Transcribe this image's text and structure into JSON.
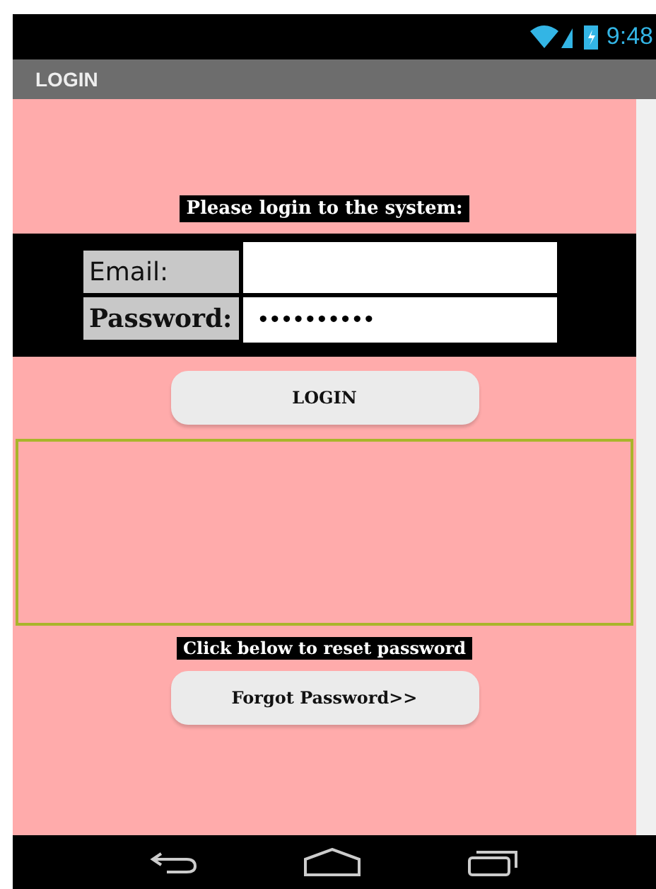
{
  "status_bar": {
    "time": "9:48"
  },
  "title_bar": {
    "title": "LOGIN"
  },
  "form": {
    "heading": "Please login to the system:",
    "fields": [
      {
        "label": "Email:",
        "kind": "text"
      },
      {
        "label": "Password:",
        "value": "••••••••••",
        "kind": "password"
      }
    ],
    "login_button": "LOGIN"
  },
  "reset": {
    "caption": "Click below to reset password",
    "button": "Forgot Password>>"
  }
}
